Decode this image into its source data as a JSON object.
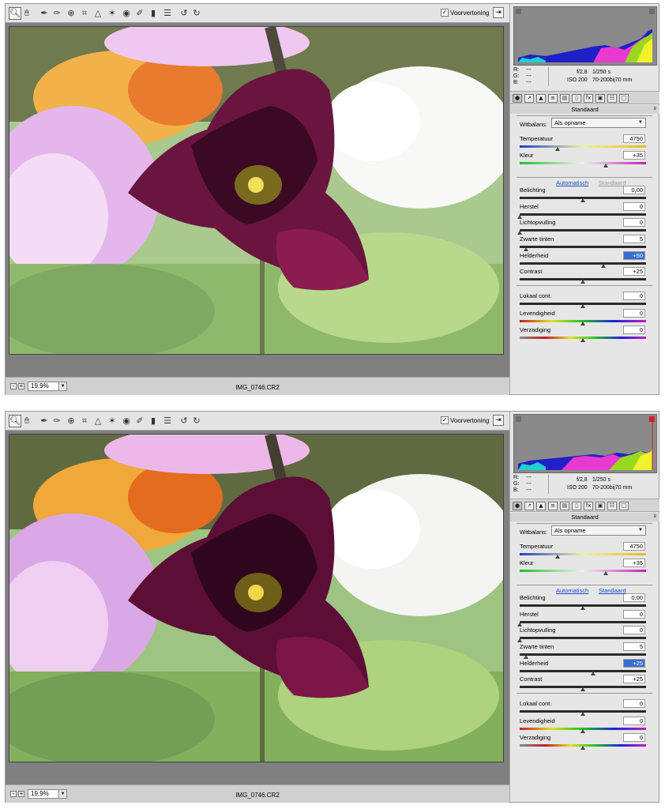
{
  "screens": [
    {
      "toolbar": {
        "tools": [
          "zoom-icon",
          "hand-icon",
          "white-balance-icon",
          "color-sampler-icon",
          "target-adjust-icon",
          "crop-icon",
          "straighten-icon",
          "spot-removal-icon",
          "red-eye-icon",
          "adjustment-brush-icon",
          "graduated-filter-icon",
          "preferences-icon",
          "rotate-left-icon",
          "rotate-right-icon"
        ],
        "preview_label": "Voorvertoning",
        "preview_checked": true
      },
      "status": {
        "zoom": "19,9%",
        "filename": "IMG_0746.CR2"
      },
      "info": {
        "r": "R:",
        "g": "G:",
        "b": "B:",
        "r_val": "---",
        "g_val": "---",
        "b_val": "---",
        "aperture": "f/2,8",
        "shutter": "1/250 s",
        "iso": "ISO 200",
        "lens": "70-200bij70 mm"
      },
      "panel": {
        "title": "Standaard",
        "wb_label": "Witbalans:",
        "wb_value": "Als opname",
        "auto_label": "Automatisch",
        "default_label": "Standaard",
        "sliders": [
          {
            "label": "Temperatuur",
            "value": "4750",
            "pos": 0.3
          },
          {
            "label": "Kleur",
            "value": "+35",
            "pos": 0.68
          },
          {
            "label": "Belichting",
            "value": "0,00",
            "pos": 0.5
          },
          {
            "label": "Herstel",
            "value": "0",
            "pos": 0.0
          },
          {
            "label": "Lichtopvulling",
            "value": "0",
            "pos": 0.0
          },
          {
            "label": "Zwarte tinten",
            "value": "5",
            "pos": 0.05
          },
          {
            "label": "Helderheid",
            "value": "+50",
            "pos": 0.66,
            "selected": true
          },
          {
            "label": "Contrast",
            "value": "+25",
            "pos": 0.5
          },
          {
            "label": "Lokaal cont.",
            "value": "0",
            "pos": 0.5
          },
          {
            "label": "Levendigheid",
            "value": "0",
            "pos": 0.5
          },
          {
            "label": "Verzadiging",
            "value": "0",
            "pos": 0.5
          }
        ]
      }
    },
    {
      "toolbar": {
        "tools": [
          "zoom-icon",
          "hand-icon",
          "white-balance-icon",
          "color-sampler-icon",
          "target-adjust-icon",
          "crop-icon",
          "straighten-icon",
          "spot-removal-icon",
          "red-eye-icon",
          "adjustment-brush-icon",
          "graduated-filter-icon",
          "preferences-icon",
          "rotate-left-icon",
          "rotate-right-icon"
        ],
        "preview_label": "Voorvertoning",
        "preview_checked": true
      },
      "status": {
        "zoom": "19,9%",
        "filename": "IMG_0746.CR2"
      },
      "info": {
        "r": "R:",
        "g": "G:",
        "b": "B:",
        "r_val": "---",
        "g_val": "---",
        "b_val": "---",
        "aperture": "f/2,8",
        "shutter": "1/250 s",
        "iso": "ISO 200",
        "lens": "70-200bij70 mm"
      },
      "panel": {
        "title": "Standaard",
        "wb_label": "Witbalans:",
        "wb_value": "Als opname",
        "auto_label": "Automatisch",
        "default_label": "Standaard",
        "sliders": [
          {
            "label": "Temperatuur",
            "value": "4750",
            "pos": 0.3
          },
          {
            "label": "Kleur",
            "value": "+35",
            "pos": 0.68
          },
          {
            "label": "Belichting",
            "value": "0,00",
            "pos": 0.5
          },
          {
            "label": "Herstel",
            "value": "0",
            "pos": 0.0
          },
          {
            "label": "Lichtopvulling",
            "value": "0",
            "pos": 0.0
          },
          {
            "label": "Zwarte tinten",
            "value": "5",
            "pos": 0.05
          },
          {
            "label": "Helderheid",
            "value": "+25",
            "pos": 0.58,
            "selected": true
          },
          {
            "label": "Contrast",
            "value": "+25",
            "pos": 0.5
          },
          {
            "label": "Lokaal cont.",
            "value": "0",
            "pos": 0.5
          },
          {
            "label": "Levendigheid",
            "value": "0",
            "pos": 0.5
          },
          {
            "label": "Verzadiging",
            "value": "0",
            "pos": 0.5
          }
        ]
      }
    }
  ]
}
